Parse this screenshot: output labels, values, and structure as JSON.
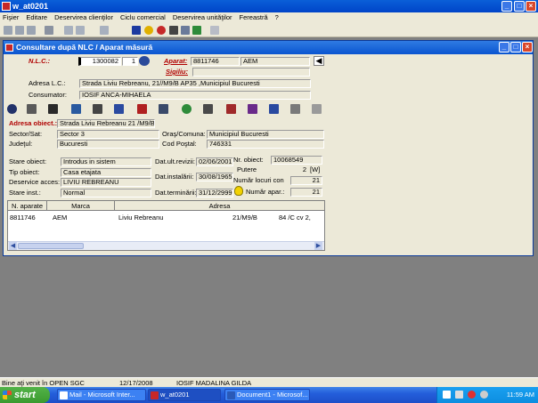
{
  "app": {
    "title": "w_at0201"
  },
  "menu": [
    "Fişier",
    "Editare",
    "Deservirea clienţilor",
    "Ciclu comercial",
    "Deservirea unităţilor",
    "Fereastră",
    "?"
  ],
  "child": {
    "title": "Consultare după NLC / Aparat măsură",
    "nlc": {
      "label": "N.L.C.:",
      "value": "1300082",
      "suffix": "1"
    },
    "aparat": {
      "label": "Aparat:",
      "number": "8811746",
      "brand": "AEM"
    },
    "sigiliu": {
      "label": "Sigiliu:"
    },
    "adresa_lc": {
      "label": "Adresa L.C.:",
      "value": "Strada Liviu Rebreanu, 21//M9/B AP35 ,Municipiul Bucuresti"
    },
    "consumator": {
      "label": "Consumator:",
      "value": "IOSIF  ANCA-MIHAELA"
    },
    "adresa_obiect": {
      "label": "Adresa obiect.:",
      "value": "Strada Liviu Rebreanu 21 /M9/B"
    },
    "sector": {
      "label": "Sector/Sat:",
      "value": "Sector 3"
    },
    "oras": {
      "label": "Oraş/Comuna:",
      "value": "Municipiul Bucuresti"
    },
    "judet": {
      "label": "Judeţul:",
      "value": "Bucuresti"
    },
    "cod_postal": {
      "label": "Cod Poştal:",
      "value": "746331"
    },
    "stare_obiect": {
      "label": "Stare obiect:",
      "value": "Introdus in sistem"
    },
    "tip_obiect": {
      "label": "Tip obiect:",
      "value": "Casa etajata"
    },
    "deservire": {
      "label": "Deservice acces:",
      "value": "LIVIU REBREANU"
    },
    "stare_inst": {
      "label": "Stare inst.:",
      "value": "Normal"
    },
    "dat_revizii": {
      "label": "Dat.ult.revizii:",
      "value": "02/06/2001"
    },
    "dat_instalarii": {
      "label": "Dat.instalării:",
      "value": "30/08/1965"
    },
    "dat_terminarii": {
      "label": "Dat.terminării:",
      "value": "31/12/2999"
    },
    "nr_obiect": {
      "label": "Nr. obiect:",
      "value": "10068549"
    },
    "putere": {
      "label": "Putere",
      "value": "2",
      "unit": "[W]"
    },
    "numar_locuri": {
      "label": "Număr locuri con",
      "value": "21"
    },
    "numar_apar": {
      "label": "Număr apar.:",
      "value": "21"
    }
  },
  "grid": {
    "columns": [
      "N. aparate",
      "Marca",
      "Adresa"
    ],
    "rows": [
      {
        "aparat": "8811746",
        "marca": "AEM",
        "adresa": "Liviu Rebreanu",
        "nr": "21/M9/B",
        "extra": "84 /C cv 2,"
      }
    ]
  },
  "status": {
    "message": "Bine aţi venit în OPEN SGC",
    "date": "12/17/2008",
    "user": "IOSIF MADALINA GILDA"
  },
  "taskbar": {
    "start": "start",
    "tasks": [
      "Mail - Microsoft Inter...",
      "w_at0201",
      "Document1 - Microsof..."
    ],
    "clock": "11:59 AM"
  },
  "colors": {
    "accent": "#0a55d0",
    "label_red": "#b00000",
    "highlight": "#1c4aa8"
  }
}
